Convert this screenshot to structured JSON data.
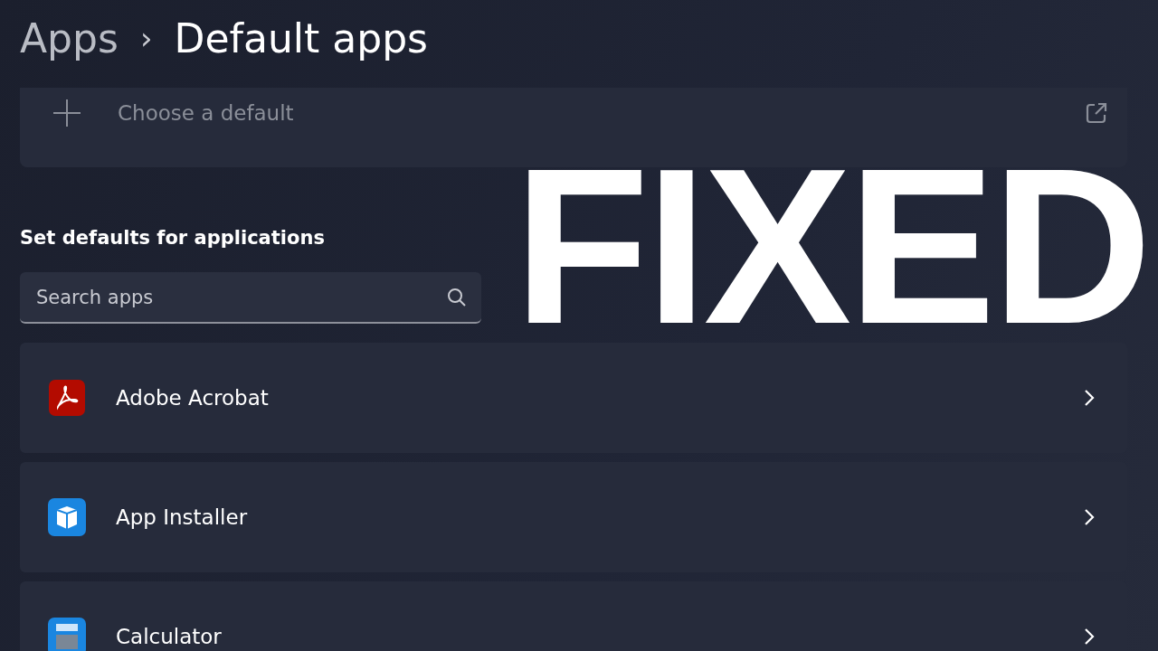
{
  "breadcrumb": {
    "parent": "Apps",
    "separator": "›",
    "current": "Default apps"
  },
  "choose_default": {
    "label": "Choose a default"
  },
  "section_heading": "Set defaults for applications",
  "search": {
    "placeholder": "Search apps"
  },
  "apps": [
    {
      "name": "Adobe Acrobat",
      "kind": "acrobat"
    },
    {
      "name": "App Installer",
      "kind": "installer"
    },
    {
      "name": "Calculator",
      "kind": "calculator"
    }
  ],
  "overlay": {
    "text": "FIXED"
  }
}
